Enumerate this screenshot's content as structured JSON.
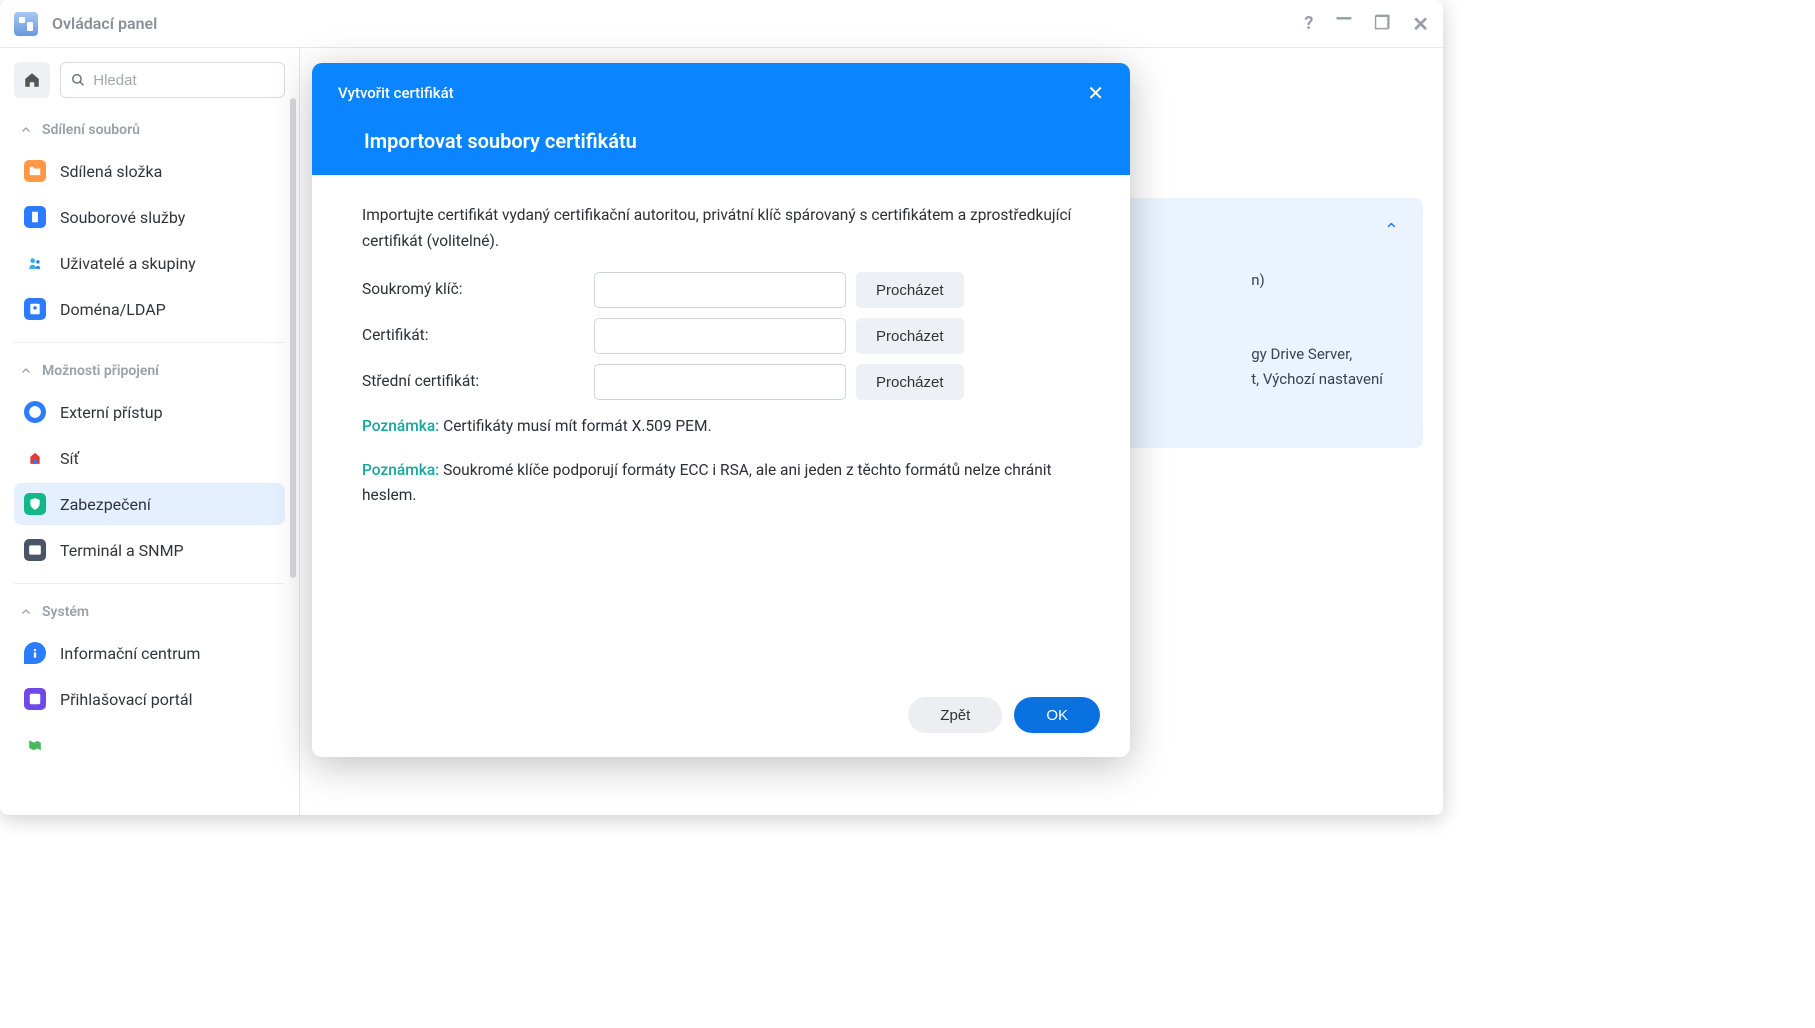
{
  "window": {
    "title": "Ovládací panel"
  },
  "search": {
    "placeholder": "Hledat"
  },
  "sidebar": {
    "sections": [
      {
        "label": "Sdílení souborů",
        "items": [
          {
            "label": "Sdílená složka"
          },
          {
            "label": "Souborové služby"
          },
          {
            "label": "Uživatelé a skupiny"
          },
          {
            "label": "Doména/LDAP"
          }
        ]
      },
      {
        "label": "Možnosti připojení",
        "items": [
          {
            "label": "Externí přístup"
          },
          {
            "label": "Síť"
          },
          {
            "label": "Zabezpečení"
          },
          {
            "label": "Terminál a SNMP"
          }
        ]
      },
      {
        "label": "Systém",
        "items": [
          {
            "label": "Informační centrum"
          },
          {
            "label": "Přihlašovací portál"
          }
        ]
      }
    ]
  },
  "content_card": {
    "line1_suffix": "gy Drive Server,",
    "line2_suffix": "t, Výchozí nastavení",
    "line0_suffix": "n)"
  },
  "dialog": {
    "heading_small": "Vytvořit certifikát",
    "heading_large": "Importovat soubory certifikátu",
    "intro": "Importujte certifikát vydaný certifikační autoritou, privátní klíč spárovaný s certifikátem a zprostředkující certifikát (volitelné).",
    "fields": {
      "private_key": "Soukromý klíč:",
      "certificate": "Certifikát:",
      "intermediate": "Střední certifikát:",
      "browse": "Procházet"
    },
    "note_label": "Poznámka:",
    "note1": " Certifikáty musí mít formát X.509 PEM.",
    "note2": " Soukromé klíče podporují formáty ECC i RSA, ale ani jeden z těchto formátů nelze chránit heslem.",
    "back": "Zpět",
    "ok": "OK"
  }
}
